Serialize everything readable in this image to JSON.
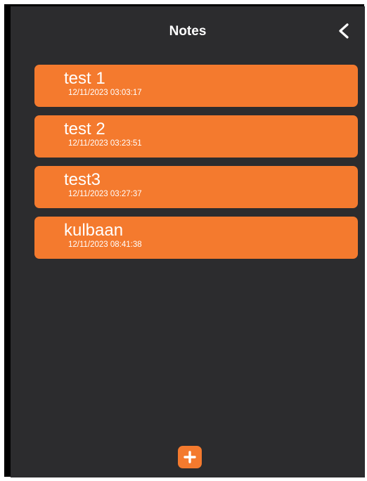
{
  "header": {
    "title": "Notes",
    "back_icon": "chevron-left-icon"
  },
  "notes": [
    {
      "title": "test 1",
      "timestamp": "12/11/2023 03:03:17"
    },
    {
      "title": "test 2",
      "timestamp": "12/11/2023 03:23:51"
    },
    {
      "title": "test3",
      "timestamp": "12/11/2023 03:27:37"
    },
    {
      "title": "kulbaan",
      "timestamp": "12/11/2023 08:41:38"
    }
  ],
  "fab": {
    "icon": "plus-icon"
  },
  "colors": {
    "background": "#2c2c2e",
    "accent": "#f47a2e",
    "text": "#ffffff"
  }
}
